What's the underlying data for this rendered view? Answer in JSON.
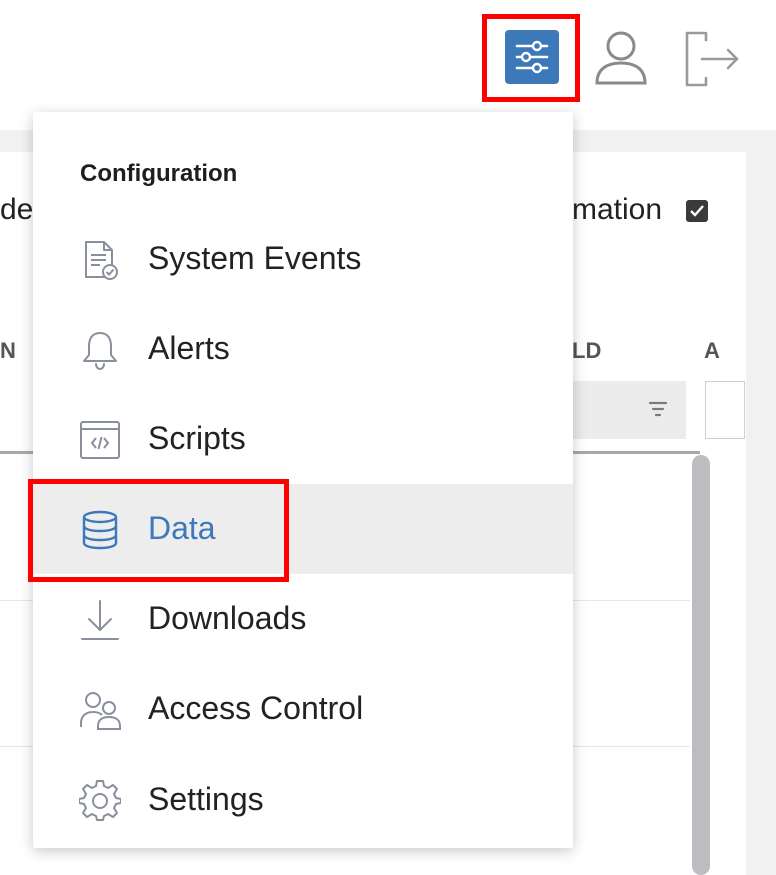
{
  "header": {
    "config_button_icon": "sliders-icon",
    "user_icon": "user-icon",
    "logout_icon": "logout-icon",
    "accent_color": "#3d78b9"
  },
  "background": {
    "left_text": "de",
    "right_text": "mation",
    "column_left": "N",
    "column_right": "LD",
    "column_far": "A"
  },
  "menu": {
    "section_title": "Configuration",
    "items": [
      {
        "label": "System Events",
        "icon": "document-check-icon"
      },
      {
        "label": "Alerts",
        "icon": "bell-icon"
      },
      {
        "label": "Scripts",
        "icon": "code-window-icon"
      },
      {
        "label": "Data",
        "icon": "database-icon",
        "active": true
      },
      {
        "label": "Downloads",
        "icon": "download-icon"
      },
      {
        "label": "Access Control",
        "icon": "users-icon"
      },
      {
        "label": "Settings",
        "icon": "gear-icon"
      }
    ]
  },
  "annotations": {
    "highlight_color": "#ff0000"
  }
}
